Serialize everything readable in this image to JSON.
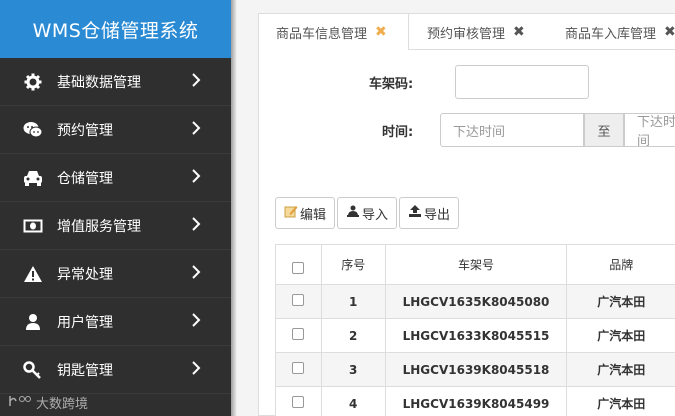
{
  "app": {
    "title": "WMS仓储管理系统"
  },
  "sidebar": {
    "items": [
      {
        "label": "基础数据管理",
        "icon": "gear-icon"
      },
      {
        "label": "预约管理",
        "icon": "chat-icon"
      },
      {
        "label": "仓储管理",
        "icon": "car-icon"
      },
      {
        "label": "增值服务管理",
        "icon": "money-icon"
      },
      {
        "label": "异常处理",
        "icon": "warning-icon"
      },
      {
        "label": "用户管理",
        "icon": "user-icon"
      },
      {
        "label": "钥匙管理",
        "icon": "key-icon"
      }
    ]
  },
  "watermark": {
    "text": "大数跨境"
  },
  "tabs": [
    {
      "label": "商品车信息管理",
      "close": "✖"
    },
    {
      "label": "预约审核管理",
      "close": "✖"
    },
    {
      "label": "商品车入库管理",
      "close": "✖"
    }
  ],
  "filters": {
    "vin_label": "车架码:",
    "vin_value": "",
    "time_label": "时间:",
    "time_start_placeholder": "下达时间",
    "time_sep": "至",
    "time_end_placeholder": "下达时间"
  },
  "toolbar": {
    "edit": "编辑",
    "import": "导入",
    "export": "导出"
  },
  "table": {
    "headers": [
      "序号",
      "车架号",
      "品牌"
    ],
    "rows": [
      [
        "1",
        "LHGCV1635K8045080",
        "广汽本田"
      ],
      [
        "2",
        "LHGCV1633K8045515",
        "广汽本田"
      ],
      [
        "3",
        "LHGCV1639K8045518",
        "广汽本田"
      ],
      [
        "4",
        "LHGCV1639K8045499",
        "广汽本田"
      ]
    ]
  },
  "colors": {
    "logo_bg": "#2a8ad4",
    "sidebar_bg": "#2f2f2f",
    "active_close": "#f0ad4e"
  }
}
